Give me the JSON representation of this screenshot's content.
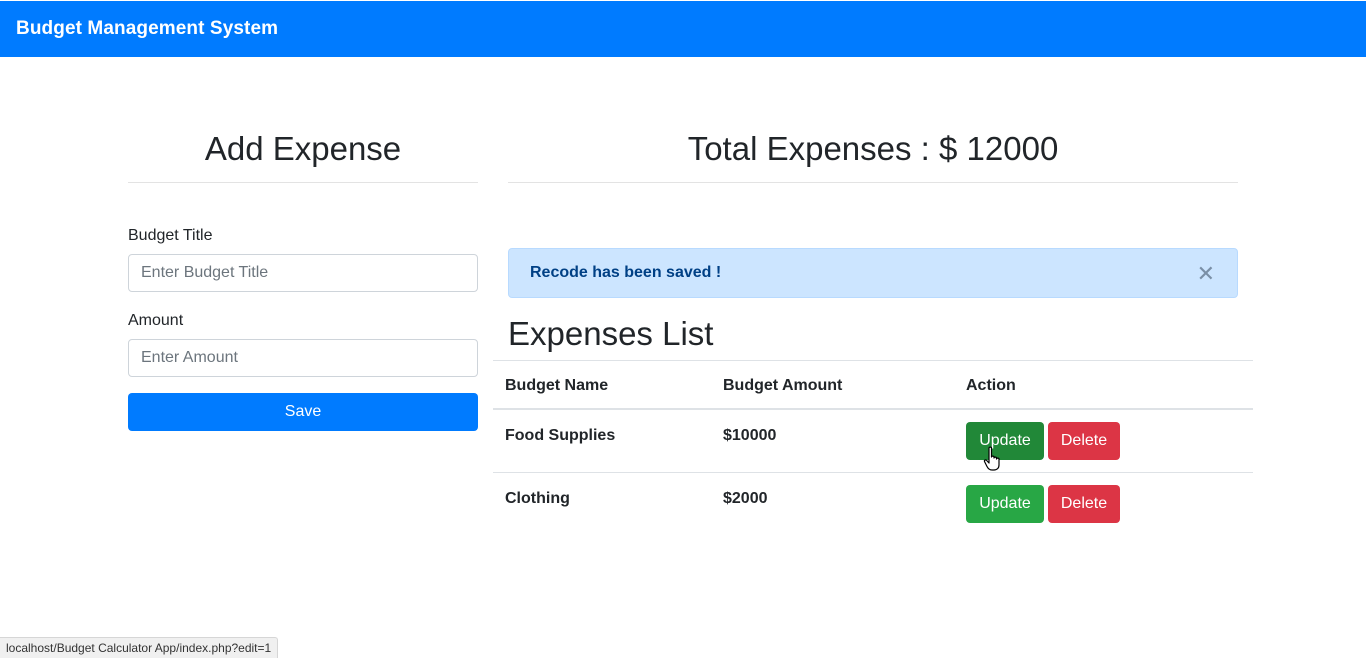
{
  "navbar": {
    "brand": "Budget Management System"
  },
  "add_expense": {
    "title": "Add Expense",
    "budget_title_label": "Budget Title",
    "budget_title_placeholder": "Enter Budget Title",
    "budget_title_value": "",
    "amount_label": "Amount",
    "amount_placeholder": "Enter Amount",
    "amount_value": "",
    "save_label": "Save"
  },
  "summary": {
    "total_label": "Total Expenses : $ 12000"
  },
  "alert": {
    "message": "Recode has been saved !",
    "close_glyph": "✕"
  },
  "expenses": {
    "title": "Expenses List",
    "columns": [
      "Budget Name",
      "Budget Amount",
      "Action"
    ],
    "rows": [
      {
        "name": "Food Supplies",
        "amount": "$10000",
        "update_label": "Update",
        "delete_label": "Delete"
      },
      {
        "name": "Clothing",
        "amount": "$2000",
        "update_label": "Update",
        "delete_label": "Delete"
      }
    ]
  },
  "status_bar": {
    "url": "localhost/Budget Calculator App/index.php?edit=1"
  },
  "colors": {
    "primary": "#007bff",
    "success": "#28a745",
    "success_hover": "#218838",
    "danger": "#dc3545",
    "alert_bg": "#cce5ff",
    "alert_text": "#004085"
  }
}
